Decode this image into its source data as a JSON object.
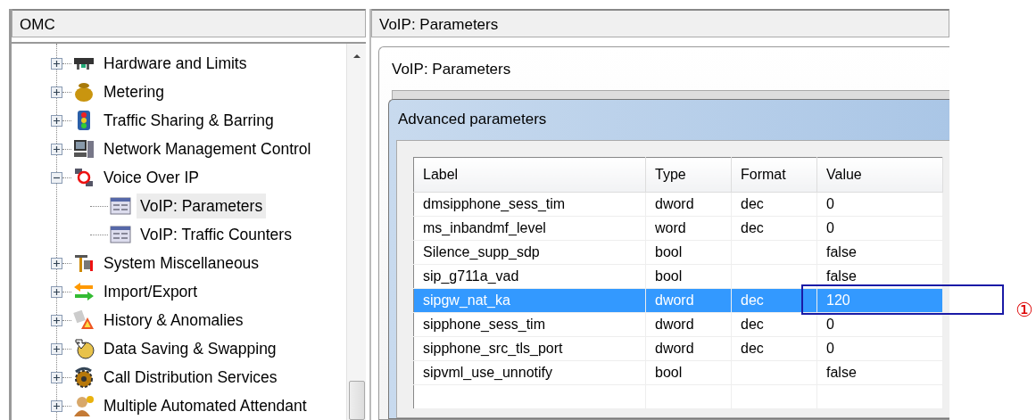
{
  "left_panel": {
    "title": "OMC",
    "tree": [
      {
        "label": "Hardware and Limits",
        "expanded": false,
        "selected": false
      },
      {
        "label": "Metering",
        "expanded": false,
        "selected": false
      },
      {
        "label": "Traffic Sharing & Barring",
        "expanded": false,
        "selected": false
      },
      {
        "label": "Network Management Control",
        "expanded": false,
        "selected": false
      },
      {
        "label": "Voice Over IP",
        "expanded": true,
        "selected": false,
        "children": [
          {
            "label": "VoIP: Parameters",
            "selected": true
          },
          {
            "label": "VoIP: Traffic Counters",
            "selected": false
          }
        ]
      },
      {
        "label": "System Miscellaneous",
        "expanded": false,
        "selected": false
      },
      {
        "label": "Import/Export",
        "expanded": false,
        "selected": false
      },
      {
        "label": "History & Anomalies",
        "expanded": false,
        "selected": false
      },
      {
        "label": "Data Saving & Swapping",
        "expanded": false,
        "selected": false
      },
      {
        "label": "Call Distribution Services",
        "expanded": false,
        "selected": false
      },
      {
        "label": "Multiple Automated Attendant",
        "expanded": false,
        "selected": false
      }
    ]
  },
  "right_panel": {
    "title": "VoIP: Parameters",
    "window": {
      "title": "VoIP: Parameters",
      "dialog": {
        "title": "Advanced parameters",
        "table": {
          "columns": [
            "Label",
            "Type",
            "Format",
            "Value"
          ],
          "rows": [
            {
              "cells": [
                "dmsipphone_sess_tim",
                "dword",
                "dec",
                "0"
              ],
              "selected": false
            },
            {
              "cells": [
                "ms_inbandmf_level",
                "word",
                "dec",
                "0"
              ],
              "selected": false
            },
            {
              "cells": [
                "Silence_supp_sdp",
                "bool",
                "",
                "false"
              ],
              "selected": false
            },
            {
              "cells": [
                "sip_g711a_vad",
                "bool",
                "",
                "false"
              ],
              "selected": false
            },
            {
              "cells": [
                "sipgw_nat_ka",
                "dword",
                "dec",
                "120"
              ],
              "selected": true
            },
            {
              "cells": [
                "sipphone_sess_tim",
                "dword",
                "dec",
                "0"
              ],
              "selected": false
            },
            {
              "cells": [
                "sipphone_src_tls_port",
                "dword",
                "dec",
                "0"
              ],
              "selected": false
            },
            {
              "cells": [
                "sipvml_use_unnotify",
                "bool",
                "",
                "false"
              ],
              "selected": false
            }
          ]
        }
      }
    }
  },
  "annotation": {
    "marker": "①"
  }
}
